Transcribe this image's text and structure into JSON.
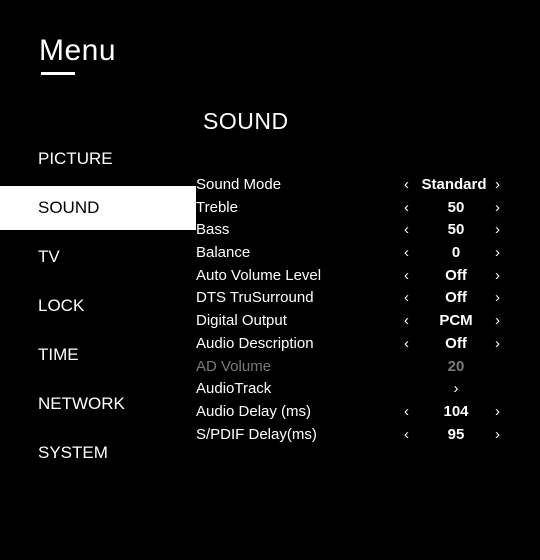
{
  "menu": {
    "title": "Menu"
  },
  "section_title": "SOUND",
  "sidebar": {
    "items": [
      {
        "label": "PICTURE"
      },
      {
        "label": "SOUND"
      },
      {
        "label": "TV"
      },
      {
        "label": "LOCK"
      },
      {
        "label": "TIME"
      },
      {
        "label": "NETWORK"
      },
      {
        "label": "SYSTEM"
      }
    ],
    "active": "SOUND"
  },
  "arrows": {
    "left": "‹",
    "right": "›"
  },
  "settings": [
    {
      "label": "Sound Mode",
      "value": "Standard"
    },
    {
      "label": "Treble",
      "value": "50"
    },
    {
      "label": "Bass",
      "value": "50"
    },
    {
      "label": "Balance",
      "value": "0"
    },
    {
      "label": "Auto Volume Level",
      "value": "Off"
    },
    {
      "label": "DTS TruSurround",
      "value": "Off"
    },
    {
      "label": "Digital Output",
      "value": "PCM"
    },
    {
      "label": "Audio Description",
      "value": "Off"
    },
    {
      "label": "AD Volume",
      "value": "20"
    },
    {
      "label": "AudioTrack",
      "value": "›"
    },
    {
      "label": "Audio Delay (ms)",
      "value": "104"
    },
    {
      "label": "S/PDIF Delay(ms)",
      "value": "95"
    }
  ],
  "colors": {
    "background": "#000000",
    "text": "#ffffff",
    "active_bg": "#ffffff",
    "disabled_text": "#7a7a7a"
  }
}
